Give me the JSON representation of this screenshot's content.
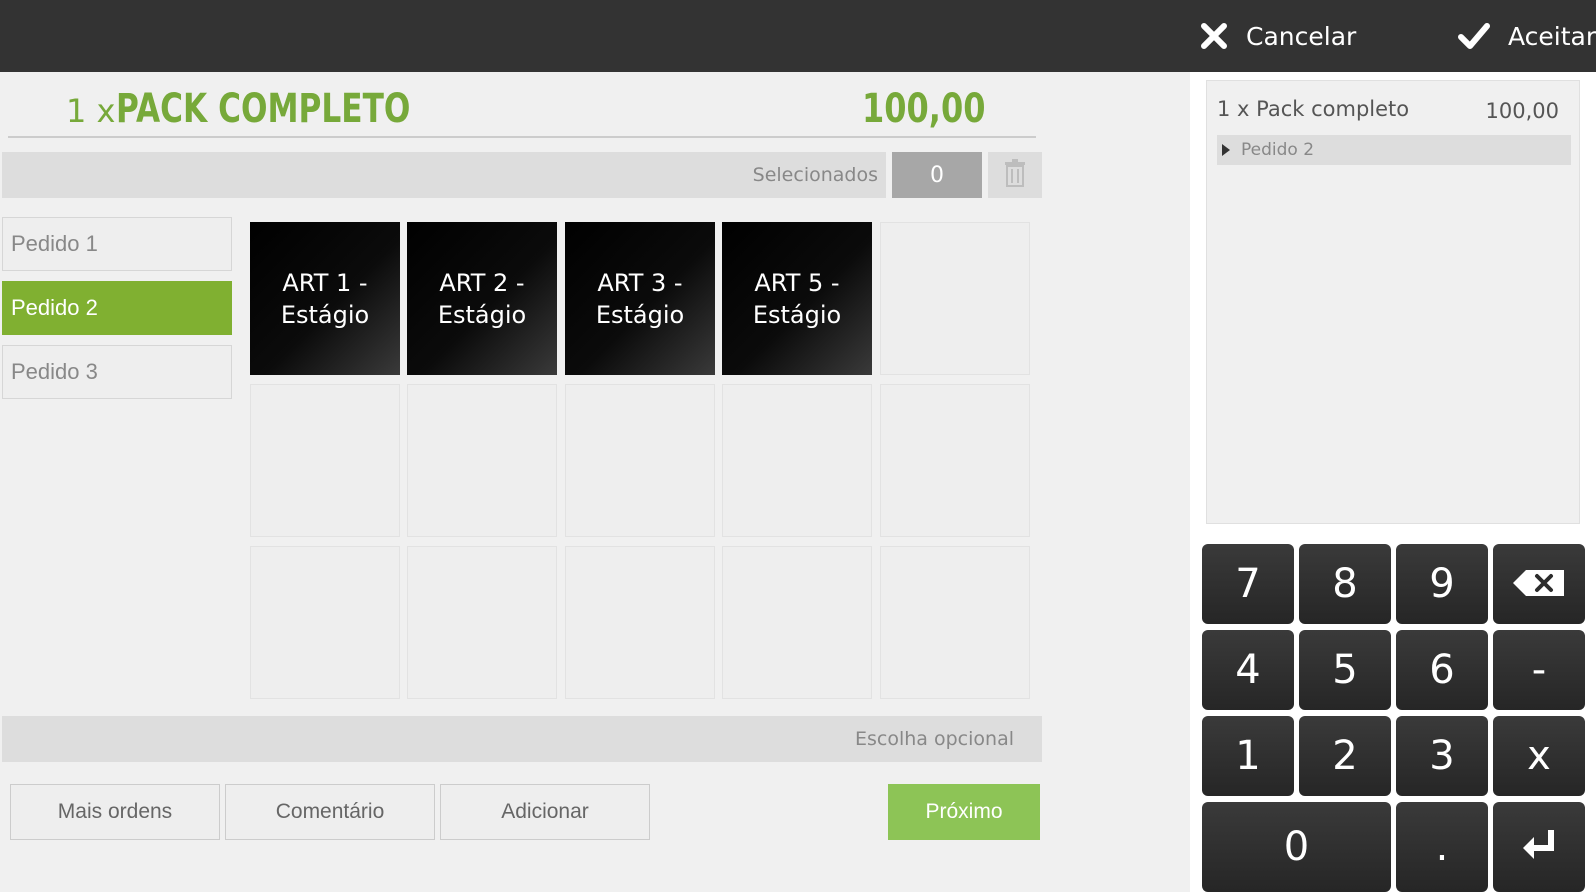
{
  "header": {
    "cancel_label": "Cancelar",
    "accept_label": "Aceitar"
  },
  "item": {
    "quantity": "1 x",
    "name": "PACK COMPLETO",
    "price": "100,00"
  },
  "selection": {
    "label": "Selecionados",
    "count": "0"
  },
  "orders": [
    {
      "label": "Pedido 1",
      "active": false
    },
    {
      "label": "Pedido 2",
      "active": true
    },
    {
      "label": "Pedido 3",
      "active": false
    }
  ],
  "articles": [
    {
      "label": "ART 1 - Estágio"
    },
    {
      "label": "ART 2 - Estágio"
    },
    {
      "label": "ART 3 - Estágio"
    },
    {
      "label": "ART 5 - Estágio"
    }
  ],
  "optional_label": "Escolha opcional",
  "actions": {
    "more_orders": "Mais ordens",
    "comment": "Comentário",
    "add": "Adicionar",
    "next": "Próximo"
  },
  "summary": {
    "line": "1 x Pack completo",
    "price": "100,00",
    "sub_order": "Pedido 2"
  },
  "keypad": {
    "k7": "7",
    "k8": "8",
    "k9": "9",
    "k4": "4",
    "k5": "5",
    "k6": "6",
    "minus": "-",
    "k1": "1",
    "k2": "2",
    "k3": "3",
    "times": "x",
    "k0": "0",
    "dot": "."
  },
  "colors": {
    "accent_green": "#80b031",
    "title_green": "#77a93a",
    "next_green": "#8dc456",
    "topbar": "#333333"
  }
}
